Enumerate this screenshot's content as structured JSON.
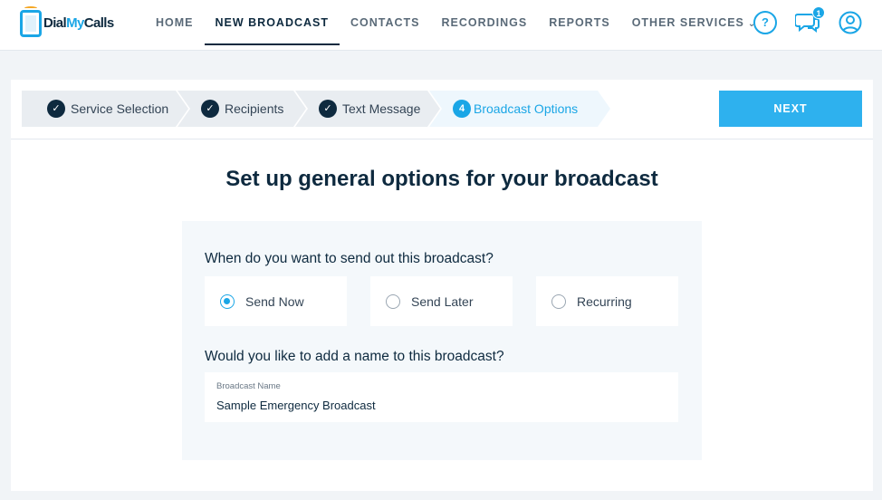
{
  "brand": {
    "name_part1": "Dial",
    "name_part2": "My",
    "name_part3": "Calls"
  },
  "nav": {
    "items": [
      {
        "label": "HOME"
      },
      {
        "label": "NEW BROADCAST"
      },
      {
        "label": "CONTACTS"
      },
      {
        "label": "RECORDINGS"
      },
      {
        "label": "REPORTS"
      },
      {
        "label": "OTHER SERVICES"
      }
    ],
    "active": "NEW BROADCAST"
  },
  "header_icons": {
    "help": "help-icon",
    "help_glyph": "?",
    "chat": "chat-icon",
    "chat_badge": "1",
    "user": "user-icon"
  },
  "wizard": {
    "steps": [
      {
        "label": "Service Selection",
        "state": "done"
      },
      {
        "label": "Recipients",
        "state": "done"
      },
      {
        "label": "Text Message",
        "state": "done"
      },
      {
        "label": "Broadcast Options",
        "state": "current",
        "number": "4"
      }
    ],
    "next_label": "NEXT"
  },
  "page": {
    "title": "Set up general options for your broadcast"
  },
  "form": {
    "send_question": "When do you want to send out this broadcast?",
    "send_options": [
      {
        "label": "Send Now",
        "selected": true
      },
      {
        "label": "Send Later",
        "selected": false
      },
      {
        "label": "Recurring",
        "selected": false
      }
    ],
    "name_question": "Would you like to add a name to this broadcast?",
    "name_field": {
      "label": "Broadcast Name",
      "value": "Sample Emergency Broadcast"
    }
  },
  "colors": {
    "accent": "#1aa6e6",
    "button": "#2eb1ee",
    "navy": "#0e2a3f",
    "background": "#f1f4f7"
  }
}
